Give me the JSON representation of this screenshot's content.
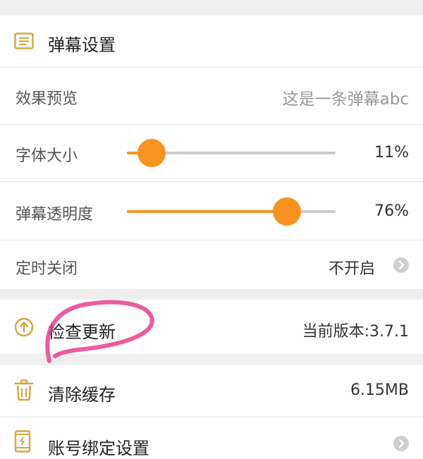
{
  "header": {
    "title": "弹幕设置",
    "icon": "list-icon"
  },
  "settings": {
    "preview": {
      "label": "效果预览",
      "value": "这是一条弹幕abc"
    },
    "font_size": {
      "label": "字体大小",
      "value_text": "11%",
      "level": 0.11
    },
    "opacity": {
      "label": "弹幕透明度",
      "value_text": "76%",
      "level": 0.76
    },
    "timer": {
      "label": "定时关闭",
      "value": "不开启"
    }
  },
  "update": {
    "label": "检查更新",
    "version": "当前版本:3.7.1",
    "icon": "arrow-up-circle-icon"
  },
  "cache": {
    "label": "清除缓存",
    "size": "6.15MB",
    "icon": "trash-icon"
  },
  "account": {
    "label": "账号绑定设置",
    "icon": "phone-icon"
  },
  "colors": {
    "accent": "#f7931e",
    "icon": "#d9a441",
    "annotation": "#e83e8c",
    "background": "#efefef"
  }
}
